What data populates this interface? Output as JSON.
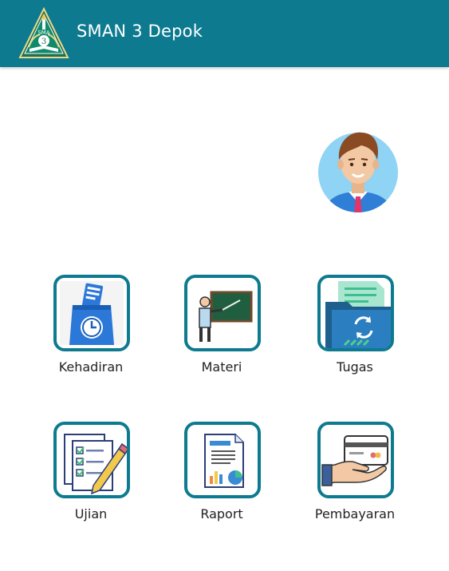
{
  "colors": {
    "brand": "#0d7a8f",
    "header_text": "#ffffff",
    "label_text": "#222222"
  },
  "header": {
    "title": "SMAN 3 Depok",
    "logo_icon": "school-crest-logo",
    "logo_text": "SMA 3"
  },
  "profile": {
    "avatar_icon": "user-avatar"
  },
  "menu": {
    "kehadiran": {
      "label": "Kehadiran",
      "icon": "attendance-clock-icon"
    },
    "materi": {
      "label": "Materi",
      "icon": "teacher-board-icon"
    },
    "tugas": {
      "label": "Tugas",
      "icon": "assignment-folder-icon"
    },
    "ujian": {
      "label": "Ujian",
      "icon": "exam-checklist-icon"
    },
    "raport": {
      "label": "Raport",
      "icon": "report-chart-icon"
    },
    "pembayaran": {
      "label": "Pembayaran",
      "icon": "payment-card-icon"
    }
  }
}
